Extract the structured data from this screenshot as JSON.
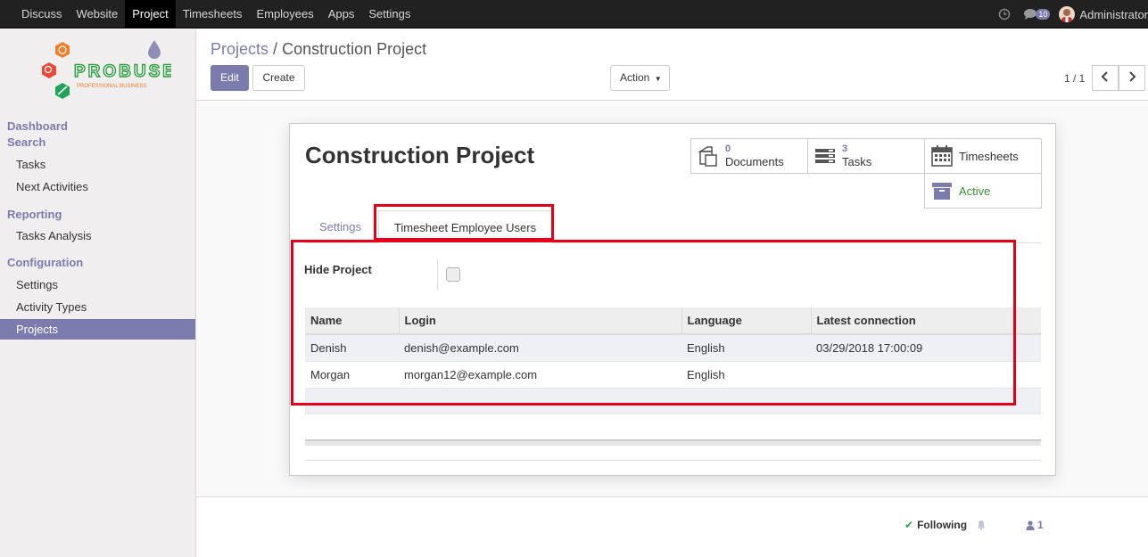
{
  "topbar": {
    "menu": [
      "Discuss",
      "Website",
      "Project",
      "Timesheets",
      "Employees",
      "Apps",
      "Settings"
    ],
    "active": "Project",
    "message_count": "10",
    "user_name": "Administrator"
  },
  "logo": {
    "text": "PROBUSE",
    "tagline": "PROFESSIONAL BUSINESS"
  },
  "sidebar": {
    "section_dashboard": "Dashboard",
    "section_search": "Search",
    "search_items": [
      "Tasks",
      "Next Activities"
    ],
    "section_reporting": "Reporting",
    "reporting_items": [
      "Tasks Analysis"
    ],
    "section_configuration": "Configuration",
    "configuration_items": [
      "Settings",
      "Activity Types",
      "Projects"
    ]
  },
  "control": {
    "breadcrumb_parent": "Projects",
    "breadcrumb_sep": "/",
    "breadcrumb_current": "Construction Project",
    "edit_label": "Edit",
    "create_label": "Create",
    "action_label": "Action",
    "pager": "1 / 1"
  },
  "form": {
    "title": "Construction Project",
    "smart_buttons": {
      "documents_count": "0",
      "documents_label": "Documents",
      "tasks_count": "3",
      "tasks_label": "Tasks",
      "timesheets_label": "Timesheets",
      "active_label": "Active"
    },
    "tabs": [
      "Settings",
      "Timesheet Employee Users"
    ],
    "active_tab": "Timesheet Employee Users",
    "hide_project_label": "Hide Project",
    "hide_project_checked": false,
    "table": {
      "headers": [
        "Name",
        "Login",
        "Language",
        "Latest connection"
      ],
      "rows": [
        [
          "Denish",
          "denish@example.com",
          "English",
          "03/29/2018 17:00:09"
        ],
        [
          "Morgan",
          "morgan12@example.com",
          "English",
          ""
        ]
      ]
    }
  },
  "chatter": {
    "following_label": "Following",
    "followers_count": "1"
  },
  "colors": {
    "brand": "#7c7bad",
    "highlight": "#e5001a",
    "topbar": "#212121",
    "active_state": "#378f37"
  }
}
